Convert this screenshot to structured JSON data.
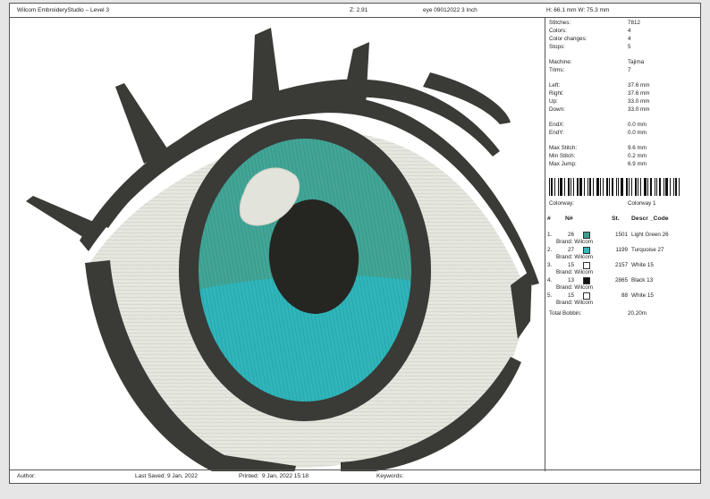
{
  "header": {
    "app_title": "Wilcom EmbroideryStudio – Level 3",
    "zoom": "Z: 2.91",
    "file": "eye 09012022 3 Inch",
    "size": "H: 66.1 mm  W: 75.3 mm"
  },
  "stats": {
    "stitches": {
      "label": "Stitches:",
      "value": "7812"
    },
    "colors": {
      "label": "Colors:",
      "value": "4"
    },
    "color_changes": {
      "label": "Color changes:",
      "value": "4"
    },
    "stops": {
      "label": "Stops:",
      "value": "5"
    },
    "machine": {
      "label": "Machine:",
      "value": "Tajima"
    },
    "trims": {
      "label": "Trims:",
      "value": "7"
    },
    "left": {
      "label": "Left:",
      "value": "37.6 mm"
    },
    "right": {
      "label": "Right:",
      "value": "37.6 mm"
    },
    "up": {
      "label": "Up:",
      "value": "33.0 mm"
    },
    "down": {
      "label": "Down:",
      "value": "33.0 mm"
    },
    "endx": {
      "label": "EndX:",
      "value": "0.0 mm"
    },
    "endy": {
      "label": "EndY:",
      "value": "0.0 mm"
    },
    "max_stitch": {
      "label": "Max Stitch:",
      "value": "9.6 mm"
    },
    "min_stitch": {
      "label": "Min Stitch:",
      "value": "0.2 mm"
    },
    "max_jump": {
      "label": "Max Jump:",
      "value": "6.9 mm"
    }
  },
  "colorway": {
    "label": "Colorway:",
    "value": "Colorway 1"
  },
  "thread_headers": {
    "num": "#",
    "n": "N#",
    "st": "St.",
    "descr": "Descr _Code"
  },
  "threads": [
    {
      "index": "1.",
      "n": "26",
      "color": "#3e9c8c",
      "stitches": "1501",
      "descr": "Light Green 26",
      "brand": "Brand: Wilcom"
    },
    {
      "index": "2.",
      "n": "27",
      "color": "#35b6b8",
      "stitches": "1199",
      "descr": "Turquoise 27",
      "brand": "Brand: Wilcom"
    },
    {
      "index": "3.",
      "n": "15",
      "color": "#ffffff",
      "stitches": "2157",
      "descr": "White 15",
      "brand": "Brand: Wilcom"
    },
    {
      "index": "4.",
      "n": "13",
      "color": "#111111",
      "stitches": "2865",
      "descr": "Black 13",
      "brand": "Brand: Wilcom"
    },
    {
      "index": "5.",
      "n": "15",
      "color": "#ffffff",
      "stitches": "88",
      "descr": "White 15",
      "brand": "Brand: Wilcom"
    }
  ],
  "total_bobbin": {
    "label": "Total Bobbin:",
    "value": "20.20m"
  },
  "footer": {
    "author_label": "Author:",
    "saved_label": "Last Saved:",
    "saved_value": "9 Jan, 2022",
    "printed_label": "Printed:",
    "printed_value": "9 Jan, 2022 15:18",
    "keywords_label": "Keywords:"
  }
}
